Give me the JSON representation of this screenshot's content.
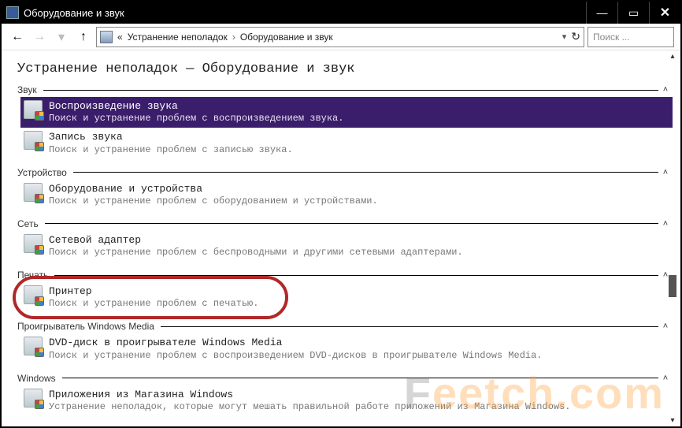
{
  "window": {
    "title": "Оборудование и звук"
  },
  "nav": {
    "crumb_prefix": "«",
    "crumb1": "Устранение неполадок",
    "crumb2": "Оборудование и звук",
    "search_placeholder": "Поиск ..."
  },
  "page": {
    "title": "Устранение неполадок — Оборудование и звук"
  },
  "groups": [
    {
      "label": "Звук",
      "items": [
        {
          "title": "Воспроизведение звука",
          "desc": "Поиск и устранение проблем с воспроизведением звука.",
          "selected": true
        },
        {
          "title": "Запись звука",
          "desc": "Поиск и устранение проблем с записью звука."
        }
      ]
    },
    {
      "label": "Устройство",
      "items": [
        {
          "title": "Оборудование и устройства",
          "desc": "Поиск и устранение проблем с оборудованием и устройствами."
        }
      ]
    },
    {
      "label": "Сеть",
      "items": [
        {
          "title": "Сетевой адаптер",
          "desc": "Поиск и устранение проблем с беспроводными и другими сетевыми адаптерами."
        }
      ]
    },
    {
      "label": "Печать",
      "items": [
        {
          "title": "Принтер",
          "desc": "Поиск и устранение проблем с печатью.",
          "highlighted": true
        }
      ]
    },
    {
      "label": "Проигрыватель Windows Media",
      "items": [
        {
          "title": "DVD-диск в проигрывателе Windows Media",
          "desc": "Поиск и устранение проблем с воспроизведением DVD-дисков в проигрывателе Windows Media."
        }
      ]
    },
    {
      "label": "Windows",
      "items": [
        {
          "title": "Приложения из Магазина Windows",
          "desc": "Устранение неполадок, которые могут мешать правильной работе приложений из Магазина Windows."
        }
      ]
    }
  ],
  "watermark": "Feetch.com"
}
